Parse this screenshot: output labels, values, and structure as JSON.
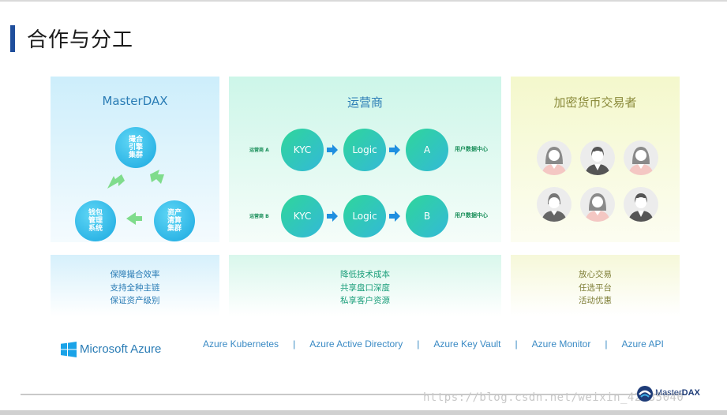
{
  "title": "合作与分工",
  "masterdax": {
    "title": "MasterDAX",
    "nodes": [
      "撮合\n引擎\n集群",
      "资产\n清算\n集群",
      "钱包\n管理\n系统"
    ],
    "features": [
      "保障撮合效率",
      "支持全种主链",
      "保证资产级别"
    ]
  },
  "operator": {
    "title": "运营商",
    "rows": [
      {
        "label": "运营商 A",
        "kyc": "KYC",
        "logic": "Logic",
        "node": "A",
        "end_label": "用户数据中心"
      },
      {
        "label": "运营商 B",
        "kyc": "KYC",
        "logic": "Logic",
        "node": "B",
        "end_label": "用户数据中心"
      }
    ],
    "features": [
      "降低技术成本",
      "共享盘口深度",
      "私享客户资源"
    ]
  },
  "traders": {
    "title": "加密货币交易者",
    "features": [
      "放心交易",
      "任选平台",
      "活动优惠"
    ]
  },
  "azure": {
    "brand": "Microsoft Azure",
    "services": [
      "Azure Kubernetes",
      "Azure Active Directory",
      "Azure Key Vault",
      "Azure Monitor",
      "Azure API"
    ],
    "separator": "|"
  },
  "footer": {
    "watermark": "https://blog.csdn.net/weixin_42135040",
    "logo_prefix": "Master",
    "logo_suffix": "DAX"
  },
  "colors": {
    "accent_blue": "#1f4e9c",
    "node_blue": "#1aa8e0",
    "node_teal": "#2fd69a",
    "arrow_green": "#7fdc8c",
    "arrow_blue": "#1f8fe0"
  }
}
